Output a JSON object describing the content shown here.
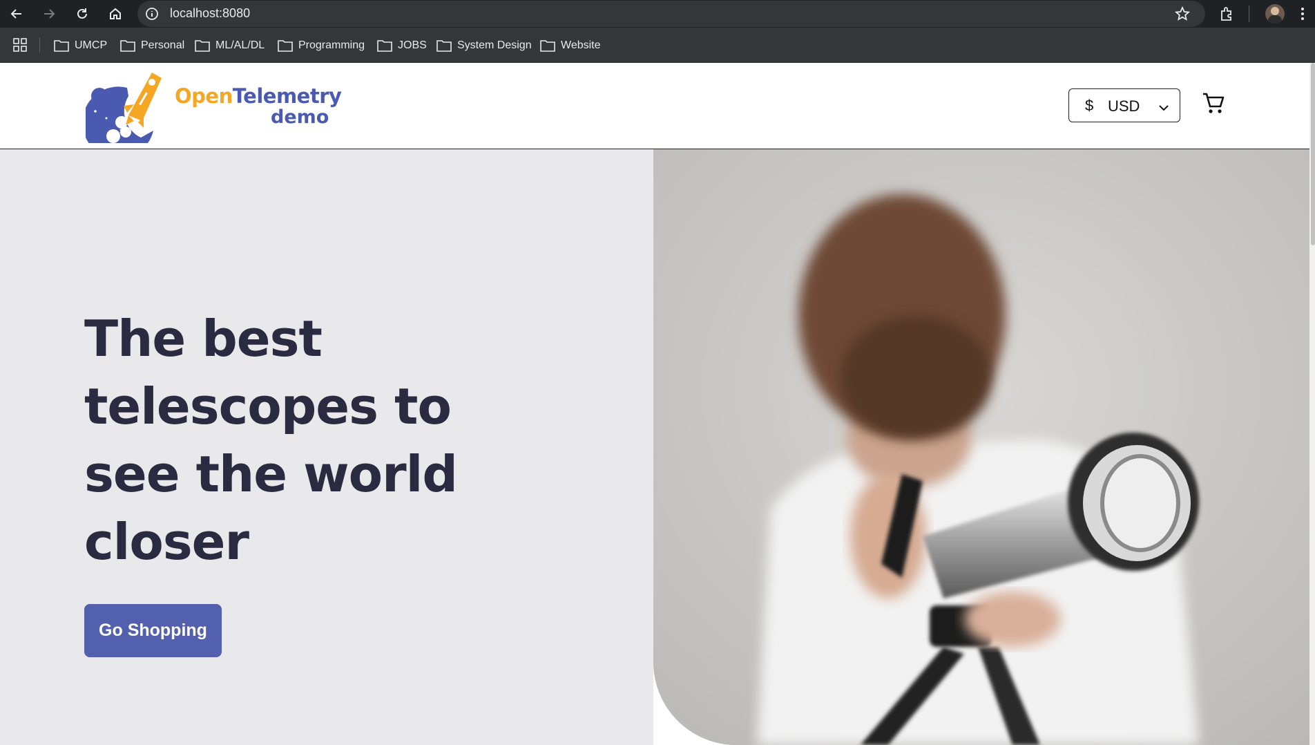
{
  "browser": {
    "url": "localhost:8080",
    "bookmarks": [
      {
        "label": "UMCP"
      },
      {
        "label": "Personal"
      },
      {
        "label": "ML/AL/DL"
      },
      {
        "label": "Programming"
      },
      {
        "label": "JOBS"
      },
      {
        "label": "System Design"
      },
      {
        "label": "Website"
      }
    ]
  },
  "header": {
    "logo_open": "Open",
    "logo_telemetry": "Telemetry",
    "logo_demo": "demo",
    "currency_symbol": "$",
    "currency_code": "USD"
  },
  "hero": {
    "headline": "The best telescopes to see the world closer",
    "cta_label": "Go Shopping"
  },
  "colors": {
    "accent": "#5360ad",
    "logo_orange": "#f5a623",
    "logo_blue": "#4a5ab0",
    "hero_bg": "#e9e9ec",
    "headline": "#2a2a40"
  }
}
